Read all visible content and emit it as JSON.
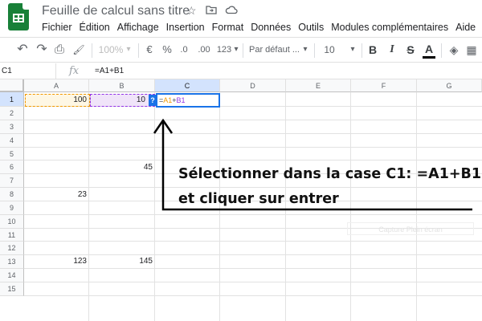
{
  "app": {
    "title": "Feuille de calcul sans titre",
    "title_icons": [
      "star-icon",
      "folder-move-icon",
      "cloud-icon"
    ],
    "menu": [
      "Fichier",
      "Édition",
      "Affichage",
      "Insertion",
      "Format",
      "Données",
      "Outils",
      "Modules complémentaires",
      "Aide"
    ]
  },
  "toolbar": {
    "undo_icon": "↶",
    "redo_icon": "↷",
    "print_icon": "⎙",
    "paint_format_icon": "🖌",
    "zoom": "100%",
    "currency": "€",
    "percent": "%",
    "decimal_decrease": ".0",
    "decimal_increase": ".00",
    "more_formats": "123",
    "font": "Par défaut ...",
    "font_size": "10",
    "bold": "B",
    "italic": "I",
    "strikethrough": "S",
    "text_color": "A",
    "fill_icon": "◈",
    "borders_icon": "▦",
    "dropdown": "▾"
  },
  "formula_bar": {
    "cell_ref": "C1",
    "fx": "fx",
    "value": "=A1+B1"
  },
  "grid": {
    "columns": [
      "A",
      "B",
      "C",
      "D",
      "E",
      "F",
      "G"
    ],
    "rows": [
      "1",
      "2",
      "3",
      "4",
      "5",
      "6",
      "7",
      "8",
      "9",
      "10",
      "11",
      "12",
      "13",
      "14",
      "15"
    ],
    "cells": {
      "A1": "100",
      "B1": "10",
      "B6": "45",
      "A8": "23",
      "A13": "123",
      "B13": "145"
    },
    "active_cell": "C1",
    "edit_text_a": "A1",
    "edit_text_op": "+",
    "edit_text_b": "B1",
    "edit_prefix": "=",
    "help_badge": "?",
    "ghost_label": "Capture Plein écran"
  },
  "annotation": {
    "line1": "Sélectionner dans la case C1: =A1+B1",
    "line2": "et cliquer sur entrer"
  },
  "colors": {
    "sheets_green": "#188038",
    "selection_blue": "#1a73e8",
    "ref_orange": "#f29900",
    "ref_purple": "#9334e6"
  }
}
